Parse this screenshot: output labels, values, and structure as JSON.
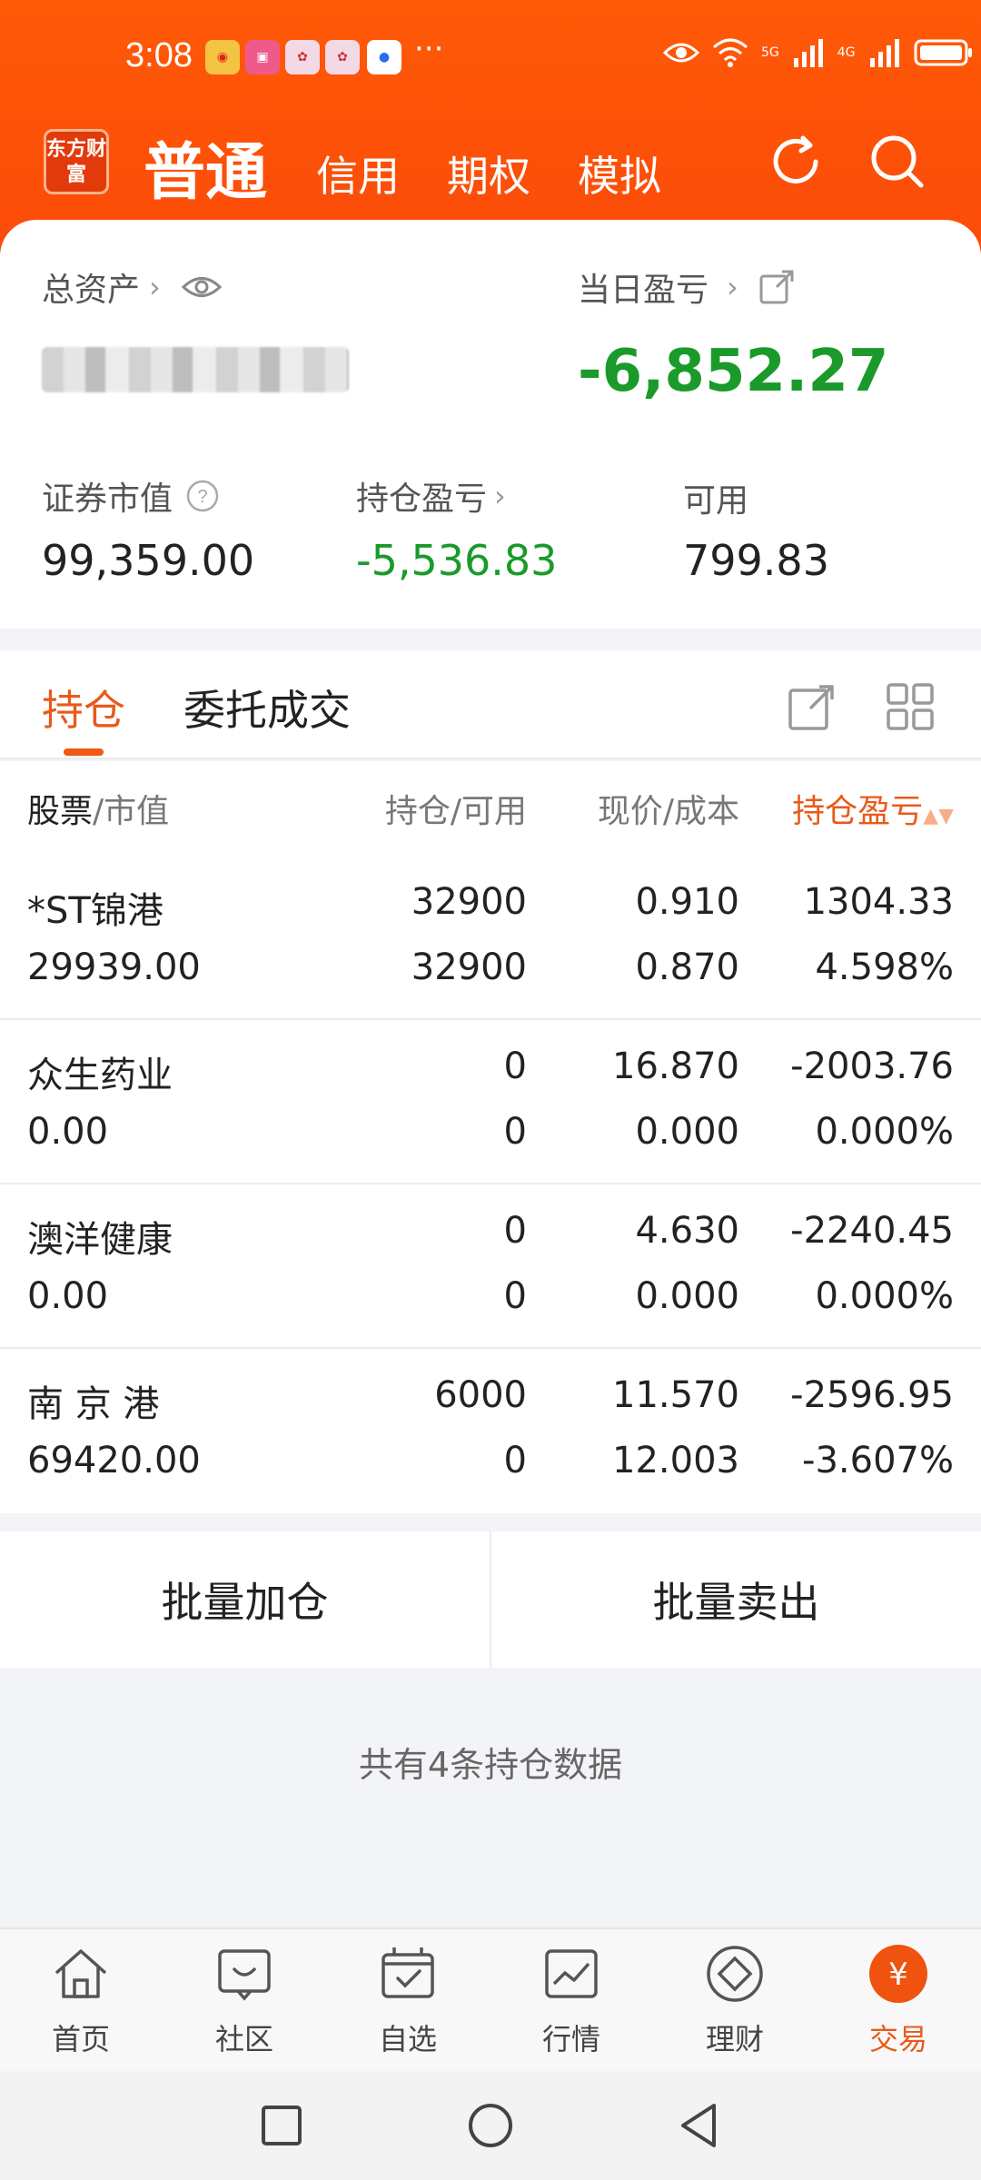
{
  "status_bar": {
    "time": "3:08",
    "notification_icons": [
      "weibo-icon",
      "huawei-app-icon",
      "game-icon",
      "game-icon",
      "app-icon"
    ],
    "network": [
      "5G",
      "4G"
    ]
  },
  "header": {
    "logo_text": "东方财富",
    "tabs": [
      {
        "label": "普通",
        "active": true
      },
      {
        "label": "信用",
        "active": false
      },
      {
        "label": "期权",
        "active": false
      },
      {
        "label": "模拟",
        "active": false
      }
    ]
  },
  "summary": {
    "total_assets_label": "总资产",
    "daily_pl_label": "当日盈亏",
    "daily_pl_value": "-6,852.27",
    "market_value_label": "证券市值",
    "market_value": "99,359.00",
    "position_pl_label": "持仓盈亏",
    "position_pl": "-5,536.83",
    "available_label": "可用",
    "available": "799.83"
  },
  "tabs": [
    {
      "label": "持仓",
      "active": true
    },
    {
      "label": "委托成交",
      "active": false
    }
  ],
  "table": {
    "headers": {
      "stock": "股票",
      "stock_sub": "/市值",
      "position": "持仓/可用",
      "price": "现价/成本",
      "pl": "持仓盈亏"
    },
    "rows": [
      {
        "name": "*ST锦港",
        "market_value": "29939.00",
        "holding": "32900",
        "available": "32900",
        "price": "0.910",
        "cost": "0.870",
        "pl": "1304.33",
        "pl_pct": "4.598%",
        "trend": "up"
      },
      {
        "name": "众生药业",
        "market_value": "0.00",
        "holding": "0",
        "available": "0",
        "price": "16.870",
        "cost": "0.000",
        "pl": "-2003.76",
        "pl_pct": "0.000%",
        "trend": "down"
      },
      {
        "name": "澳洋健康",
        "market_value": "0.00",
        "holding": "0",
        "available": "0",
        "price": "4.630",
        "cost": "0.000",
        "pl": "-2240.45",
        "pl_pct": "0.000%",
        "trend": "down"
      },
      {
        "name": "南 京 港",
        "market_value": "69420.00",
        "holding": "6000",
        "available": "0",
        "price": "11.570",
        "cost": "12.003",
        "pl": "-2596.95",
        "pl_pct": "-3.607%",
        "trend": "down"
      }
    ]
  },
  "actions": {
    "batch_add": "批量加仓",
    "batch_sell": "批量卖出"
  },
  "footer_note": "共有4条持仓数据",
  "bottom_nav": [
    {
      "label": "首页",
      "icon": "home-icon",
      "active": false
    },
    {
      "label": "社区",
      "icon": "community-icon",
      "active": false
    },
    {
      "label": "自选",
      "icon": "watchlist-icon",
      "active": false
    },
    {
      "label": "行情",
      "icon": "market-icon",
      "active": false
    },
    {
      "label": "理财",
      "icon": "wealth-icon",
      "active": false
    },
    {
      "label": "交易",
      "icon": "trade-icon",
      "active": true
    }
  ],
  "colors": {
    "brand": "#ff5a07",
    "accent": "#e85a1a",
    "loss": "#1a9a2a",
    "gain": "#d8333a"
  }
}
